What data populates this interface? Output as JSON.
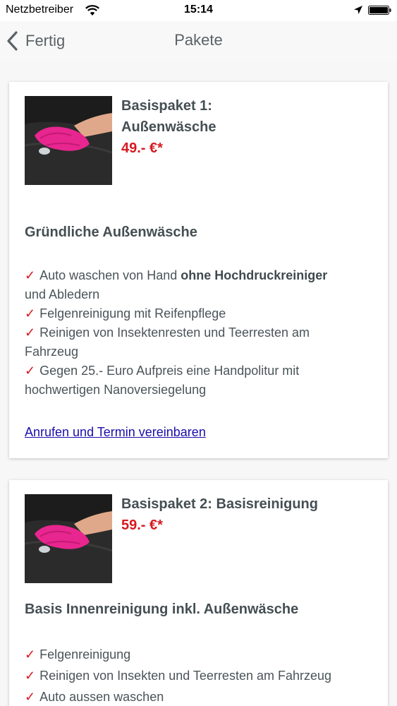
{
  "status_bar": {
    "carrier": "Netzbetreiber",
    "time": "15:14"
  },
  "nav": {
    "back_label": "Fertig",
    "title": "Pakete"
  },
  "packages": [
    {
      "title_line1": "Basispaket 1:",
      "title_line2": "Außenwäsche",
      "price": "49.- €*",
      "heading": "Gründliche Außenwäsche",
      "features": {
        "f1_text": "Auto waschen von Hand ",
        "f1_bold": "ohne Hochdruckreiniger",
        "f1_text2": "und Abledern",
        "f2": "Felgenreinigung mit Reifenpflege",
        "f3_line1": "Reinigen von Insektenresten und Teerresten am",
        "f3_line2": "Fahrzeug",
        "f4_line1": "Gegen 25.- Euro Aufpreis eine Handpolitur mit",
        "f4_line2": "hochwertigen Nanoversiegelung"
      },
      "link": "Anrufen und Termin vereinbaren"
    },
    {
      "title_line1": "Basispaket 2: Basisreinigung",
      "price": "59.- €*",
      "heading": "Basis Innenreinigung inkl. Außenwäsche",
      "features": {
        "f1": "Felgenreinigung",
        "f2": "Reinigen von Insekten und Teerresten am Fahrzeug",
        "f3": "Auto aussen waschen"
      }
    }
  ],
  "check_mark": "✓",
  "colors": {
    "price": "#d71920",
    "check": "#d71920",
    "link": "#1a0dab"
  }
}
